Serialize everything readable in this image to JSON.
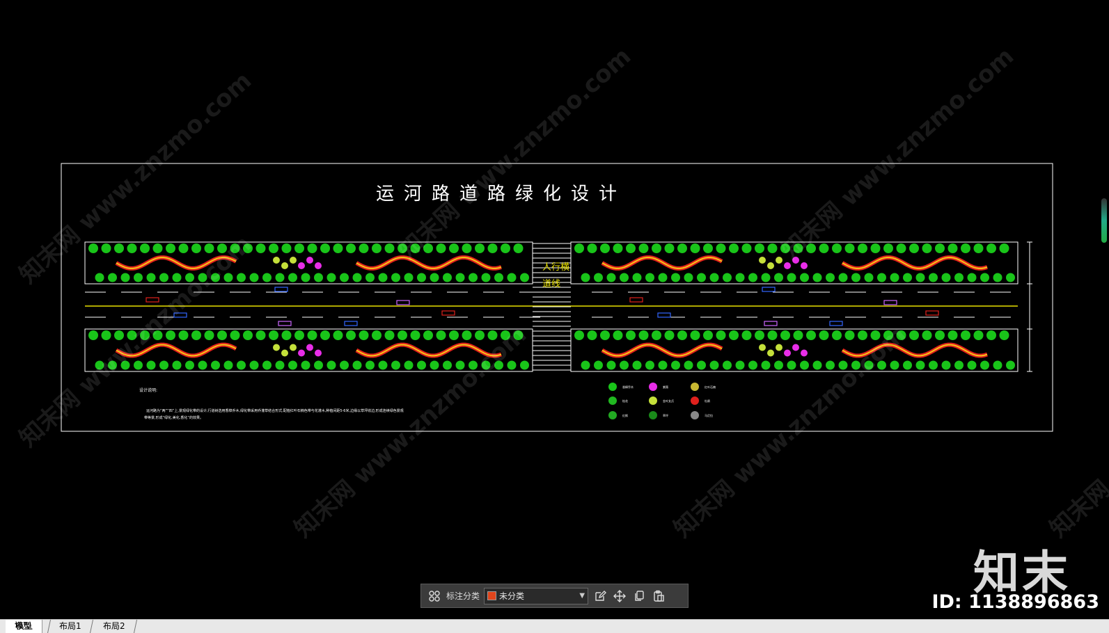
{
  "drawing": {
    "title": "运河路道路绿化设计",
    "crosswalk_label_1": "人行横",
    "crosswalk_label_2": "道线",
    "notes_heading": "设计说明:",
    "notes_line_1": "运河路为“两”“四”上,景观绿化带的设计,行道树选用香樟乔木,绿化带采用乔灌草结合形式,配植红叶石楠色带与花灌木,种植间距5-6米,边缘以草坪收边,形成连续绿色景观",
    "notes_line_2": "带等景,形成“绿化,美化,香化”的效果。",
    "legend": [
      {
        "color": "#19c419",
        "label": "香樟乔木"
      },
      {
        "color": "#e82de8",
        "label": "紫薇"
      },
      {
        "color": "#c8b832",
        "label": "红叶石楠"
      },
      {
        "color": "#20b820",
        "label": "桂花"
      },
      {
        "color": "#c4e03a",
        "label": "金叶女贞"
      },
      {
        "color": "#e0201c",
        "label": "杜鹃"
      },
      {
        "color": "#22aa22",
        "label": "红枫"
      },
      {
        "color": "#1a8a1a",
        "label": "草坪"
      },
      {
        "color": "#888888",
        "label": "马尼拉"
      }
    ]
  },
  "colors": {
    "frame": "#ffffff",
    "tree": "#19c419",
    "flower": "#e82de8",
    "hedge_red": "#e0201c",
    "hedge_yellow": "#f5c518",
    "road_line": "#e8e000"
  },
  "toolbar": {
    "grid_icon": "grid-icon",
    "annotation_label": "标注分类",
    "category_value": "未分类",
    "edit_icon": "edit-icon",
    "move_icon": "move-icon",
    "copy_icon": "copy-icon",
    "paste_icon": "paste-icon"
  },
  "watermark": {
    "text": "知末网 www.znzmo.com",
    "brand": "知末",
    "image_id": "ID: 1138896863"
  },
  "tabs": [
    "模型",
    "布局1",
    "布局2"
  ]
}
